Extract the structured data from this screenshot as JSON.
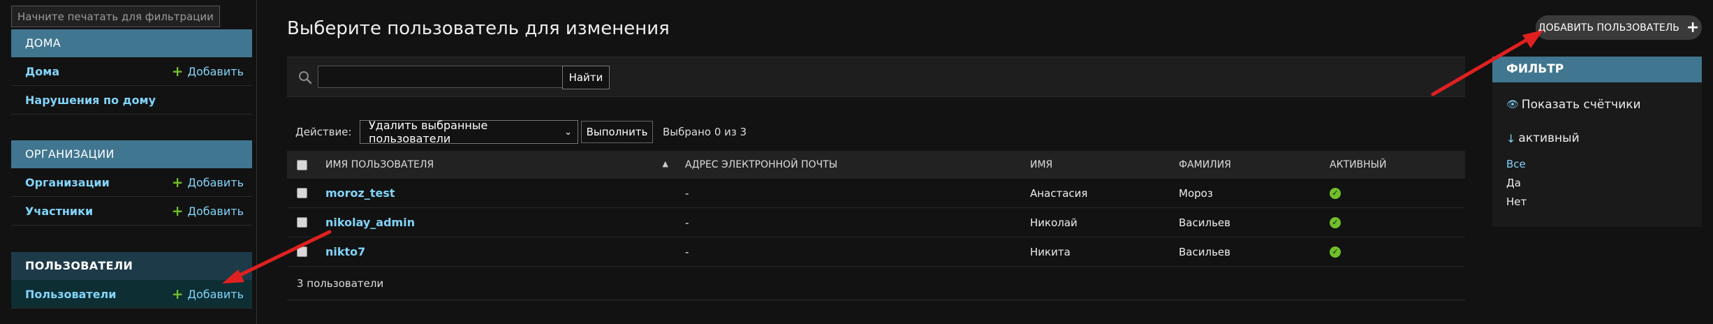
{
  "sidebar": {
    "filter_placeholder": "Начните печатать для фильтрации...",
    "modules": [
      {
        "caption": "Дома",
        "rows": [
          {
            "label": "Дома",
            "add": "Добавить"
          },
          {
            "label": "Нарушения по дому",
            "add": ""
          }
        ]
      },
      {
        "caption": "Организации",
        "rows": [
          {
            "label": "Организации",
            "add": "Добавить"
          },
          {
            "label": "Участники",
            "add": "Добавить"
          }
        ]
      },
      {
        "caption": "Пользователи",
        "rows": [
          {
            "label": "Пользователи",
            "add": "Добавить"
          }
        ]
      }
    ]
  },
  "main": {
    "title": "Выберите пользователь для изменения",
    "add_button": "Добавить пользователь",
    "search_button": "Найти",
    "action_label": "Действие:",
    "action_selected": "Удалить выбранные пользователи",
    "run_button": "Выполнить",
    "selected_count": "Выбрано 0 из 3",
    "columns": [
      "Имя пользователя",
      "Адрес электронной почты",
      "Имя",
      "Фамилия",
      "Активный"
    ],
    "rows": [
      {
        "username": "moroz_test",
        "email": "-",
        "first_name": "Анастасия",
        "last_name": "Мороз",
        "active": true
      },
      {
        "username": "nikolay_admin",
        "email": "-",
        "first_name": "Николай",
        "last_name": "Васильев",
        "active": true
      },
      {
        "username": "nikto7",
        "email": "-",
        "first_name": "Никита",
        "last_name": "Васильев",
        "active": true
      }
    ],
    "paginator": "3 пользователи"
  },
  "filter": {
    "title": "ФИЛЬТР",
    "show_counts": "Показать счётчики",
    "heading": "активный",
    "options": [
      {
        "label": "Все",
        "selected": true
      },
      {
        "label": "Да",
        "selected": false
      },
      {
        "label": "Нет",
        "selected": false
      }
    ]
  },
  "colors": {
    "accent": "#417690",
    "link": "#81d4fa",
    "add_green": "#70bf2b",
    "arrow_red": "#e02020"
  }
}
